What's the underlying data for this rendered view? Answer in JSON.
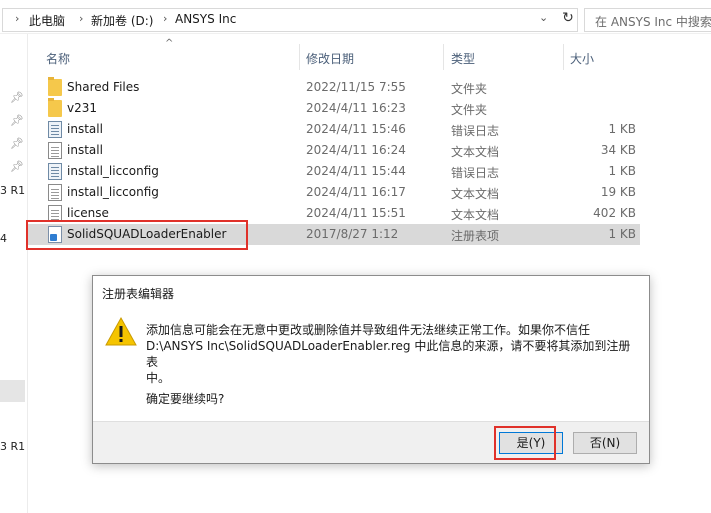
{
  "address_bar": {
    "crumbs": [
      "此电脑",
      "新加卷 (D:)",
      "ANSYS Inc"
    ],
    "search_placeholder": "在 ANSYS Inc 中搜索"
  },
  "nav_fragments": [
    "3 R1",
    "4",
    "3 R1"
  ],
  "columns": {
    "name": "名称",
    "date": "修改日期",
    "type": "类型",
    "size": "大小"
  },
  "files": [
    {
      "name": "Shared Files",
      "date": "2022/11/15 7:55",
      "type": "文件夹",
      "size": "",
      "icon": "folder-icon"
    },
    {
      "name": "v231",
      "date": "2024/4/11 16:23",
      "type": "文件夹",
      "size": "",
      "icon": "folder-icon"
    },
    {
      "name": "install",
      "date": "2024/4/11 15:46",
      "type": "错误日志",
      "size": "1 KB",
      "icon": "log-file-icon"
    },
    {
      "name": "install",
      "date": "2024/4/11 16:24",
      "type": "文本文档",
      "size": "34 KB",
      "icon": "text-file-icon"
    },
    {
      "name": "install_licconfig",
      "date": "2024/4/11 15:44",
      "type": "错误日志",
      "size": "1 KB",
      "icon": "log-file-icon"
    },
    {
      "name": "install_licconfig",
      "date": "2024/4/11 16:17",
      "type": "文本文档",
      "size": "19 KB",
      "icon": "text-file-icon"
    },
    {
      "name": "license",
      "date": "2024/4/11 15:51",
      "type": "文本文档",
      "size": "402 KB",
      "icon": "text-file-icon"
    },
    {
      "name": "SolidSQUADLoaderEnabler",
      "date": "2017/8/27 1:12",
      "type": "注册表项",
      "size": "1 KB",
      "icon": "registry-file-icon"
    }
  ],
  "dialog": {
    "title": "注册表编辑器",
    "message_line1": "添加信息可能会在无意中更改或删除值并导致组件无法继续正常工作。如果你不信任",
    "message_line2": "D:\\ANSYS Inc\\SolidSQUADLoaderEnabler.reg 中此信息的来源，请不要将其添加到注册表",
    "message_line3": "中。",
    "confirm": "确定要继续吗?",
    "yes_label": "是(Y)",
    "no_label": "否(N)",
    "icon": "warning-icon"
  },
  "colors": {
    "highlight": "#e0312a",
    "selection": "#d9d9d9",
    "warning": "#f5c400",
    "accent": "#0078d7"
  }
}
